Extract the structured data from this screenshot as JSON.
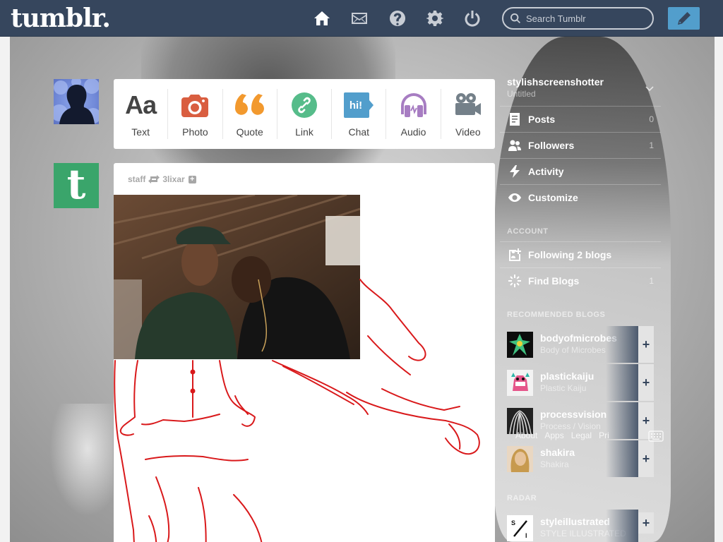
{
  "header": {
    "logo": "tumblr.",
    "search_placeholder": "Search Tumblr"
  },
  "post_types": [
    {
      "label": "Text",
      "glyph": "Aa",
      "color": "#444444"
    },
    {
      "label": "Photo",
      "color": "#d95e40"
    },
    {
      "label": "Quote",
      "color": "#f2992e"
    },
    {
      "label": "Link",
      "color": "#56bc8a"
    },
    {
      "label": "Chat",
      "glyph": "hi!",
      "color": "#529ecc"
    },
    {
      "label": "Audio",
      "color": "#a77dc2"
    },
    {
      "label": "Video",
      "color": "#748089"
    }
  ],
  "post": {
    "author": "staff",
    "reblogged_from": "3lixar",
    "follow_glyph": "+"
  },
  "sidebar": {
    "blog_name": "stylishscreenshotter",
    "blog_title": "Untitled",
    "rows": [
      {
        "label": "Posts",
        "count": "0",
        "icon": "posts-icon"
      },
      {
        "label": "Followers",
        "count": "1",
        "icon": "followers-icon"
      },
      {
        "label": "Activity",
        "count": "",
        "icon": "activity-icon"
      },
      {
        "label": "Customize",
        "count": "",
        "icon": "customize-icon"
      }
    ],
    "account_heading": "ACCOUNT",
    "account_rows": [
      {
        "label": "Following 2 blogs",
        "icon": "following-icon"
      },
      {
        "label": "Find Blogs",
        "count": "1",
        "icon": "find-blogs-icon"
      }
    ],
    "recommended_heading": "RECOMMENDED BLOGS",
    "recommended": [
      {
        "name": "bodyofmicrobes",
        "desc": "Body of Microbes"
      },
      {
        "name": "plastickaiju",
        "desc": "Plastic Kaiju"
      },
      {
        "name": "processvision",
        "desc": "Process / Vision"
      },
      {
        "name": "shakira",
        "desc": "Shakira"
      }
    ],
    "footer_links": [
      "About",
      "Apps",
      "Legal",
      "Pri"
    ],
    "radar_heading": "RADAR",
    "radar": {
      "name": "styleillustrated",
      "desc": "STYLE ILLUSTRATED"
    }
  }
}
